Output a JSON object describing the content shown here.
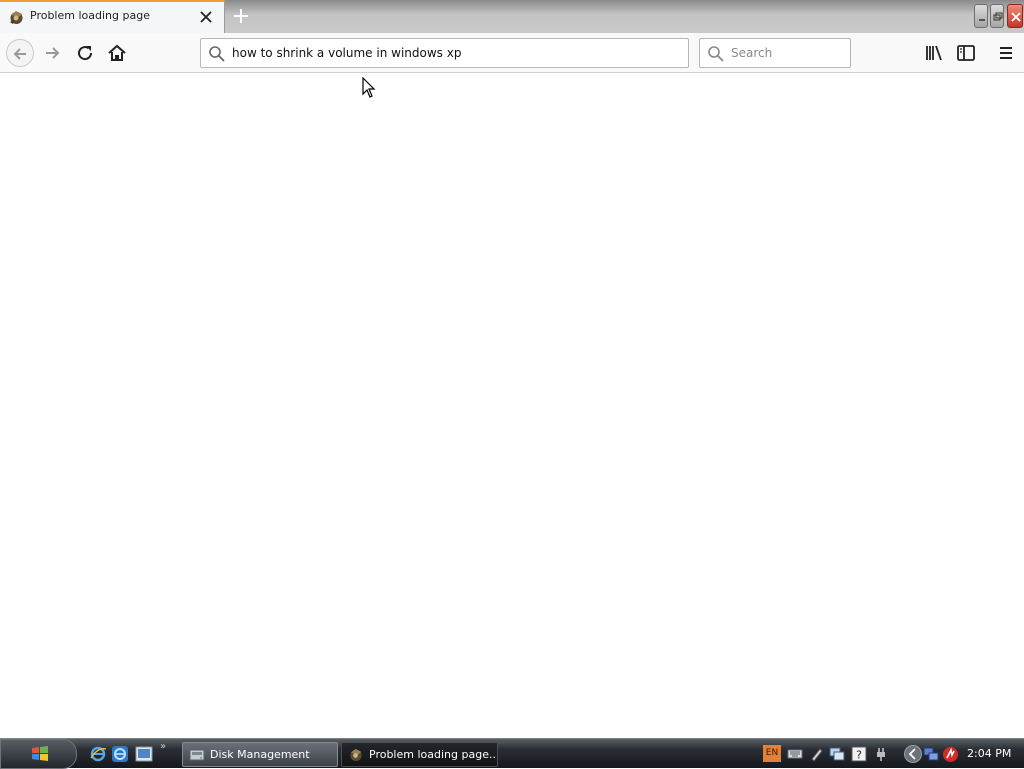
{
  "browser": {
    "tab": {
      "title": "Problem loading page",
      "favicon": "firefox-error-icon"
    },
    "window_controls": [
      "minimize-icon",
      "restore-icon",
      "close-icon"
    ],
    "navbar": {
      "url_value": "how to shrink a volume in windows xp",
      "search_placeholder": "Search",
      "buttons": [
        "back-icon",
        "forward-icon",
        "reload-icon",
        "home-icon",
        "library-icon",
        "sidebar-icon",
        "hamburger-menu-icon"
      ]
    },
    "content": {
      "state": "blank"
    }
  },
  "taskbar": {
    "quicklaunch": [
      "internet-explorer-icon",
      "internet-explorer-alt-icon",
      "show-desktop-icon"
    ],
    "items": [
      {
        "label": "Disk Management",
        "icon": "disk-management-icon"
      },
      {
        "label": "Problem loading page...",
        "icon": "firefox-error-icon"
      }
    ],
    "tray": {
      "language": "EN",
      "icons": [
        "keyboard-icon",
        "pen-icon",
        "network-icon",
        "help-icon",
        "power-icon",
        "network-monitor-icon",
        "antivirus-icon"
      ],
      "clock": "2:04 PM"
    }
  },
  "colors": {
    "tab_accent": "#f09a3a",
    "taskbar_dark": "#15181c",
    "lang_badge": "#e3813a"
  }
}
